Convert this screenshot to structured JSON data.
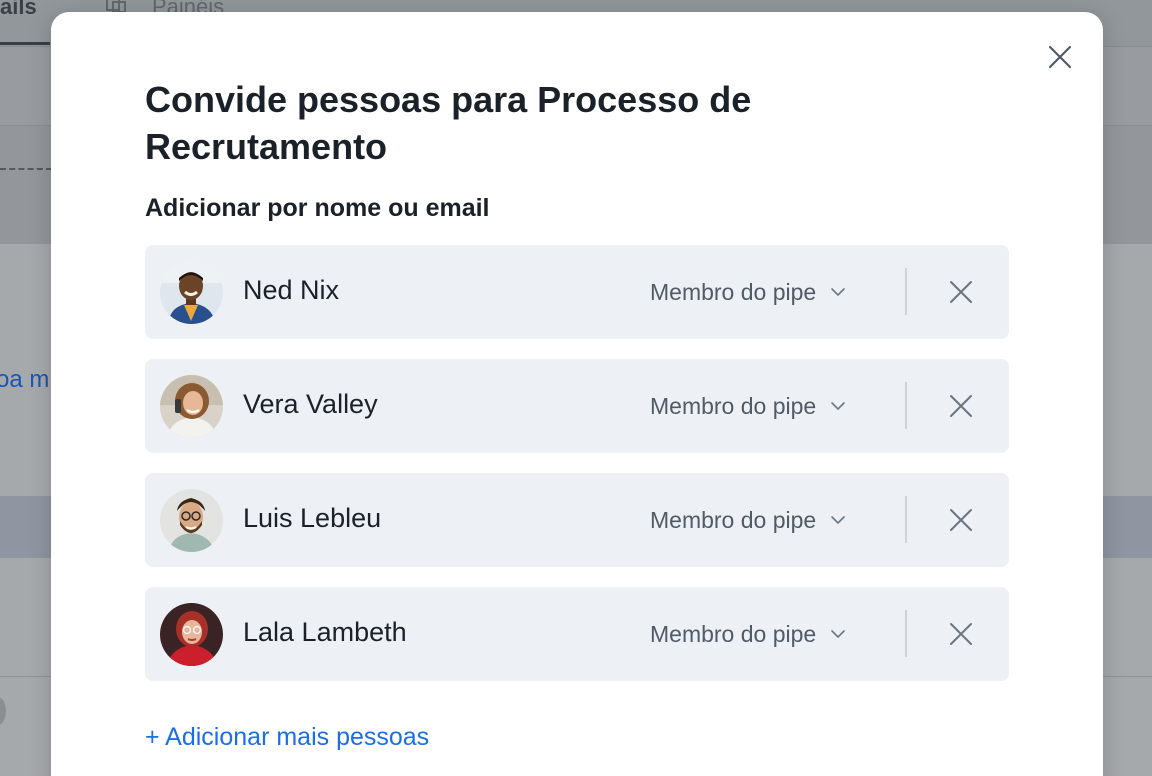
{
  "background": {
    "active_tab": "ails",
    "second_tab": "Painéis",
    "second_tab_icon": "panels-icon",
    "link_fragment": "oa m"
  },
  "modal": {
    "title": "Convide pessoas para Processo de Recrutamento",
    "section_label": "Adicionar por nome ou email",
    "close_icon": "close-icon",
    "people": [
      {
        "name": "Ned Nix",
        "role": "Membro do pipe",
        "avatar": "avatar-photo-man-dark-hair"
      },
      {
        "name": "Vera Valley",
        "role": "Membro do pipe",
        "avatar": "avatar-photo-woman-phone"
      },
      {
        "name": "Luis Lebleu",
        "role": "Membro do pipe",
        "avatar": "avatar-photo-man-curly-beard"
      },
      {
        "name": "Lala Lambeth",
        "role": "Membro do pipe",
        "avatar": "avatar-photo-woman-red-hair"
      }
    ],
    "add_more_label": "+ Adicionar mais pessoas"
  },
  "colors": {
    "accent_link": "#1a6ee6",
    "row_background": "#edf0f5",
    "title_text": "#1b2129",
    "secondary_text": "#515b66",
    "overlay": "#9a9ea3"
  }
}
